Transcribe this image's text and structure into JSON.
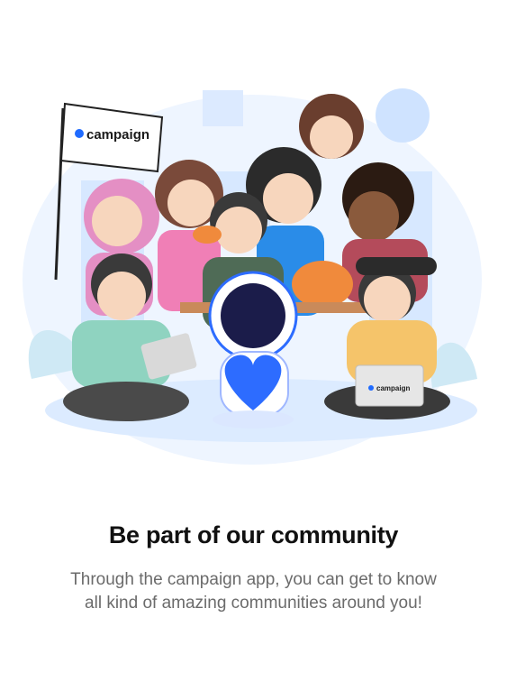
{
  "illustration": {
    "flag_text": "campaign",
    "laptop_text": "campaign",
    "colors": {
      "brand": "#1f6bff",
      "bg_blob": "#e6f1ff",
      "plant": "#cfe9f5",
      "astronaut_heart": "#2d6cff"
    }
  },
  "onboarding": {
    "title": "Be part of our community",
    "subtitle_line1": "Through the campaign app, you can get to know",
    "subtitle_line2": "all kind of amazing communities around you!"
  }
}
